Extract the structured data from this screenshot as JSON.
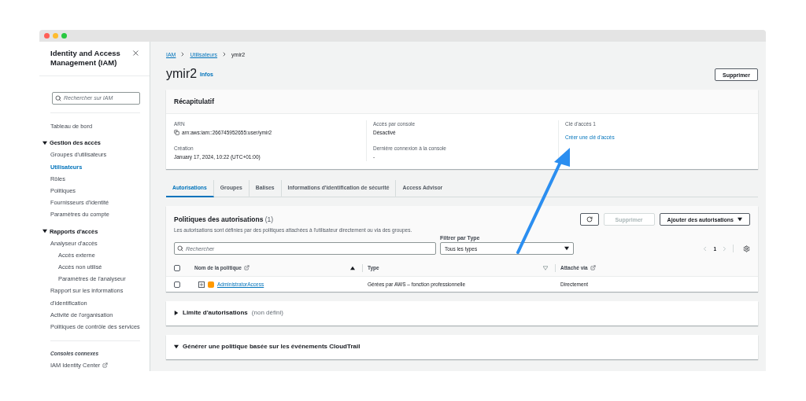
{
  "sidebar": {
    "title": "Identity and Access Management (IAM)",
    "search": {
      "placeholder": "Rechercher sur IAM"
    },
    "items": [
      {
        "kind": "link",
        "label": "Tableau de bord",
        "selected": false
      },
      {
        "kind": "group",
        "label": "Gestion des accès",
        "expanded": true,
        "children": [
          {
            "label": "Groupes d'utilisateurs",
            "selected": false
          },
          {
            "label": "Utilisateurs",
            "selected": true
          },
          {
            "label": "Rôles",
            "selected": false
          },
          {
            "label": "Politiques",
            "selected": false
          },
          {
            "label": "Fournisseurs d'identité",
            "selected": false
          },
          {
            "label": "Paramètres du compte",
            "selected": false
          }
        ]
      },
      {
        "kind": "group",
        "label": "Rapports d'accès",
        "expanded": true,
        "children": [
          {
            "label": "Analyseur d'accès",
            "selected": false,
            "children": [
              {
                "label": "Accès externe",
                "selected": false
              },
              {
                "label": "Accès non utilisé",
                "selected": false
              },
              {
                "label": "Paramètres de l'analyseur",
                "selected": false
              }
            ]
          },
          {
            "label": "Rapport sur les informations d'identification",
            "selected": false
          },
          {
            "label": "Activité de l'organisation",
            "selected": false
          },
          {
            "label": "Politiques de contrôle des services",
            "selected": false
          }
        ]
      }
    ],
    "footer_heading": "Consoles connexes",
    "footer_links": [
      "IAM Identity Center"
    ]
  },
  "breadcrumb": [
    "IAM",
    "Utilisateurs",
    "ymir2"
  ],
  "page_title": "ymir2",
  "info_link": "Infos",
  "delete_button": "Supprimer",
  "summary": {
    "heading": "Récapitulatif",
    "columns": [
      [
        {
          "label": "ARN",
          "value": "arn:aws:iam::266745952655:user/ymir2",
          "kind": "copy"
        },
        {
          "label": "Création",
          "value": "January 17, 2024, 10:22 (UTC+01:00)",
          "kind": "text"
        }
      ],
      [
        {
          "label": "Accès par console",
          "value": "Désactivé",
          "kind": "text"
        },
        {
          "label": "Dernière connexion à la console",
          "value": "-",
          "kind": "text"
        }
      ],
      [
        {
          "label": "Clé d'accès 1",
          "value": "Créer une clé d'accès",
          "kind": "link"
        }
      ]
    ]
  },
  "tabs": [
    {
      "label": "Autorisations",
      "selected": true
    },
    {
      "label": "Groupes",
      "selected": false
    },
    {
      "label": "Balises",
      "selected": false
    },
    {
      "label": "Informations d'identification de sécurité",
      "selected": false
    },
    {
      "label": "Access Advisor",
      "selected": false
    }
  ],
  "permissions": {
    "heading": "Politiques des autorisations",
    "count": "(1)",
    "description": "Les autorisations sont définies par des politiques attachées à l'utilisateur directement ou via des groupes.",
    "delete_button": {
      "label": "Supprimer",
      "disabled": true
    },
    "add_button": "Ajouter des autorisations",
    "search": {
      "placeholder": "Rechercher"
    },
    "filter": {
      "label": "Filtrer par Type",
      "value": "Tous les types"
    },
    "page": "1",
    "all_checked": false,
    "columns": [
      "Nom de la politique",
      "Type",
      "Attaché via"
    ],
    "rows": [
      {
        "name": "AdministratorAccess",
        "type": "Gérées par AWS – fonction professionnelle",
        "attached": "Directement",
        "checked": false
      }
    ]
  },
  "sections": [
    {
      "title": "Limite d'autorisations",
      "note": "(non défini)",
      "expanded": false
    },
    {
      "title": "Générer une politique basée sur les événements CloudTrail",
      "expanded": true
    }
  ]
}
